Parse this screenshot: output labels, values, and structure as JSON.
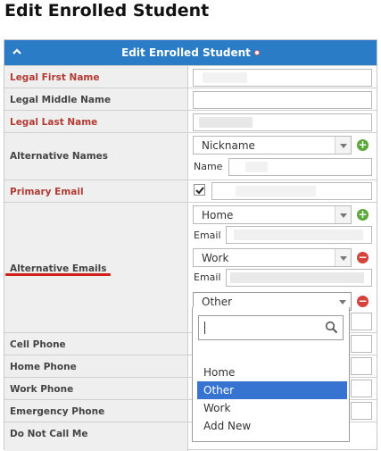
{
  "page": {
    "title": "Edit Enrolled Student"
  },
  "panel": {
    "title": "Edit Enrolled Student"
  },
  "fields": {
    "legal_first_name": {
      "label": "Legal First Name",
      "value": ""
    },
    "legal_middle_name": {
      "label": "Legal Middle Name",
      "value": ""
    },
    "legal_last_name": {
      "label": "Legal Last Name",
      "value": ""
    },
    "alternative_names": {
      "label": "Alternative Names",
      "type_value": "Nickname",
      "name_label": "Name",
      "name_value": ""
    },
    "primary_email": {
      "label": "Primary Email",
      "checked": true,
      "value": ""
    },
    "alternative_emails": {
      "label": "Alternative Emails",
      "entries": [
        {
          "type": "Home",
          "email_label": "Email",
          "email": ""
        },
        {
          "type": "Work",
          "email_label": "Email",
          "email": ""
        },
        {
          "type": "Other"
        }
      ]
    },
    "cell_phone": {
      "label": "Cell Phone"
    },
    "home_phone": {
      "label": "Home Phone"
    },
    "work_phone": {
      "label": "Work Phone"
    },
    "emergency_phone": {
      "label": "Emergency Phone"
    },
    "do_not_call_me": {
      "label": "Do Not Call Me"
    }
  },
  "dropdown": {
    "search_value": "",
    "options": [
      "Home",
      "Other",
      "Work",
      "Add New"
    ],
    "highlighted": "Other"
  },
  "colors": {
    "header": "#2b7cc6",
    "required_label": "#b23b34",
    "add": "#5aa83a",
    "remove": "#d4423a",
    "highlight": "#3774d2",
    "annotation": "#d0201a"
  }
}
